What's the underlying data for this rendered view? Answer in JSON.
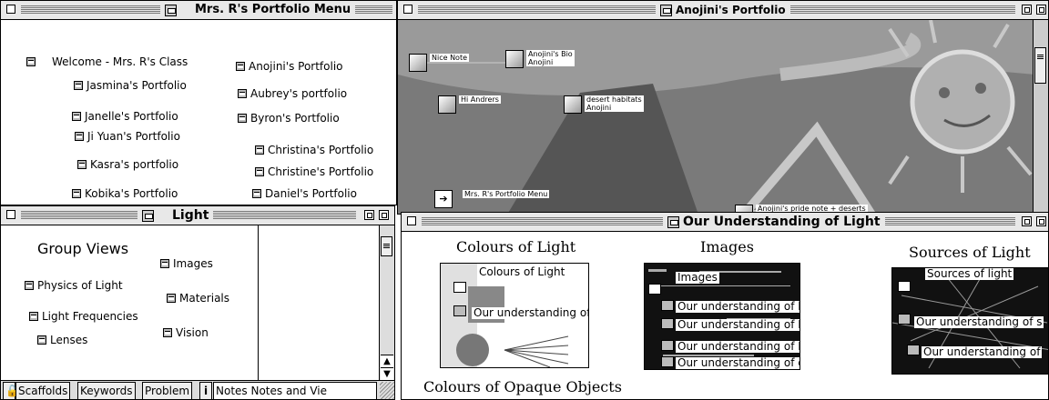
{
  "menu_window": {
    "title": "Mrs. R's Portfolio Menu",
    "links": [
      "Welcome - Mrs. R's Class",
      "Anojini's Portfolio",
      "Jasmina's  Portfolio",
      "Aubrey's portfolio",
      "Janelle's Portfolio",
      "Byron's Portfolio",
      "Ji Yuan's Portfolio",
      "Christina's Portfolio",
      "Kasra's  portfolio",
      "Christine's Portfolio",
      "Kobika's Portfolio",
      "Daniel's Portfolio"
    ]
  },
  "light_window": {
    "title": "Light",
    "heading": "Group Views",
    "links": [
      "Images",
      "Physics of Light",
      "Materials",
      "Light Frequencies",
      "Vision",
      "Lenses"
    ],
    "tabs": [
      "Scaffolds",
      "Keywords",
      "Problem",
      "i",
      "Notes Notes and Vie"
    ]
  },
  "portfolio_window": {
    "title": "Anojini's Portfolio",
    "notes": [
      "Nice Note",
      "Anojini's Bio\nAnojini",
      "Hi Andrers",
      "desert habitats\nAnojini",
      "Mrs. R's Portfolio Menu",
      "Anojini's pride note + deserts"
    ]
  },
  "understanding_window": {
    "title": "Our Understanding of Light",
    "views": [
      {
        "heading": "Colours of Light",
        "label": "Colours of Light",
        "items": [
          "Our understanding of prism"
        ]
      },
      {
        "heading": "Images",
        "label": "Images",
        "items": [
          "Our understanding of lenses",
          "Our understanding of Photographs",
          "Our understanding of Images",
          "Our understanding of cameras"
        ]
      },
      {
        "heading": "Sources of Light",
        "label": "Sources of light",
        "items": [
          "Our understanding of s",
          "Our understanding of"
        ]
      }
    ],
    "bottom_heading": "Colours of Opaque Objects"
  }
}
